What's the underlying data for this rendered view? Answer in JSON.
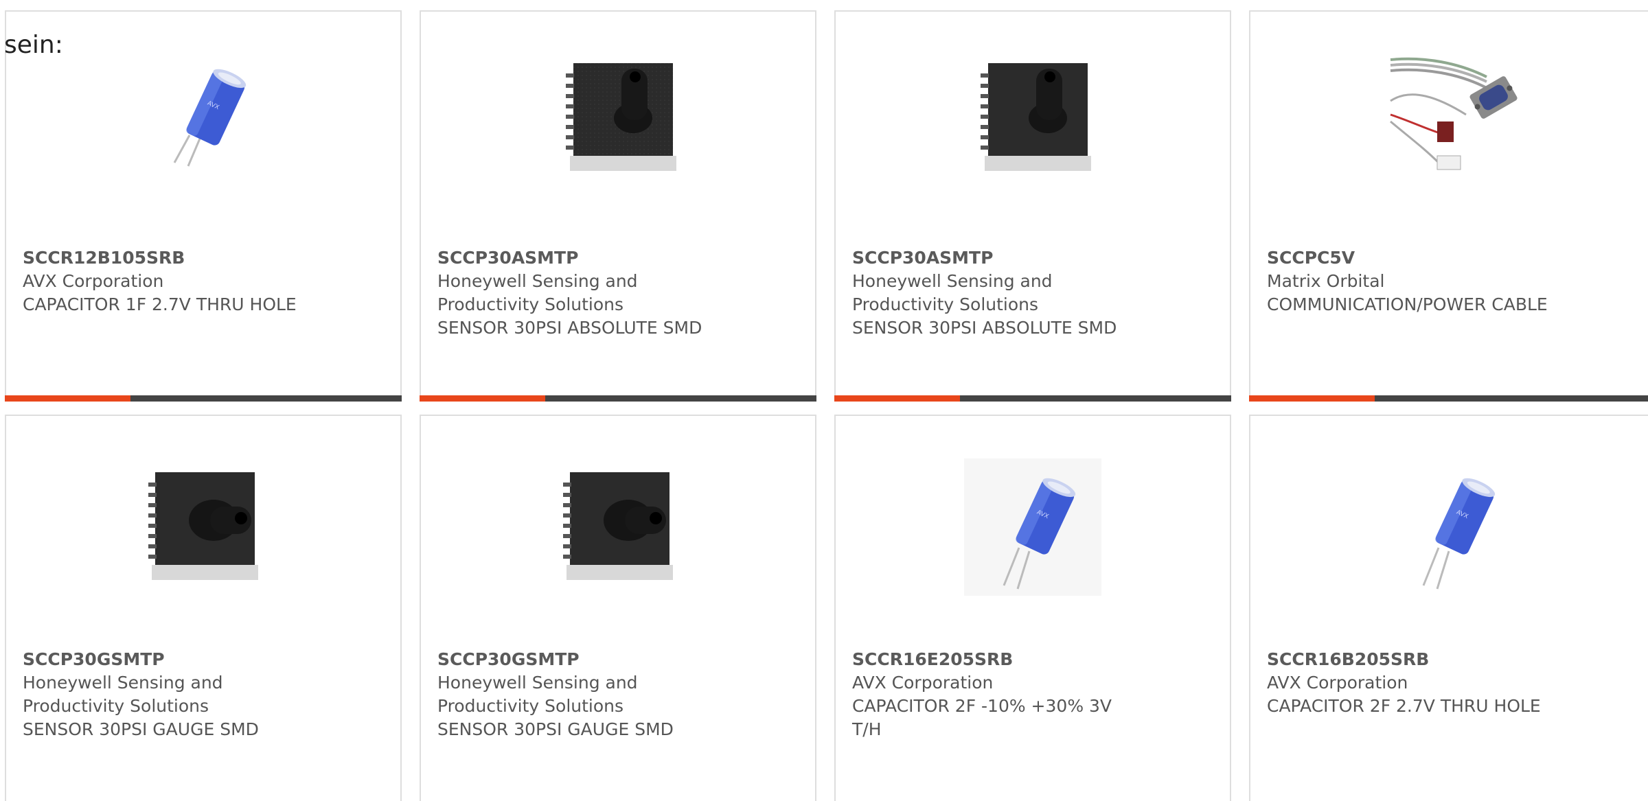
{
  "prefix_text": "sein:",
  "products": [
    {
      "part_number": "SCCR12B105SRB",
      "manufacturer": "AVX Corporation",
      "description": "CAPACITOR 1F 2.7V THRU HOLE",
      "image_icon": "capacitor-icon"
    },
    {
      "part_number": "SCCP30ASMTP",
      "manufacturer_line1": "Honeywell Sensing and",
      "manufacturer_line2": "Productivity Solutions",
      "description": "SENSOR 30PSI ABSOLUTE SMD",
      "image_icon": "pressure-sensor-icon"
    },
    {
      "part_number": "SCCP30ASMTP",
      "manufacturer_line1": "Honeywell Sensing and",
      "manufacturer_line2": "Productivity Solutions",
      "description": "SENSOR 30PSI ABSOLUTE SMD",
      "image_icon": "pressure-sensor-icon"
    },
    {
      "part_number": "SCCPC5V",
      "manufacturer": "Matrix Orbital",
      "description": "COMMUNICATION/POWER CABLE",
      "image_icon": "cable-icon"
    },
    {
      "part_number": "SCCP30GSMTP",
      "manufacturer_line1": "Honeywell Sensing and",
      "manufacturer_line2": "Productivity Solutions",
      "description": "SENSOR 30PSI GAUGE SMD",
      "image_icon": "pressure-sensor-icon"
    },
    {
      "part_number": "SCCP30GSMTP",
      "manufacturer_line1": "Honeywell Sensing and",
      "manufacturer_line2": "Productivity Solutions",
      "description": "SENSOR 30PSI GAUGE SMD",
      "image_icon": "pressure-sensor-icon"
    },
    {
      "part_number": "SCCR16E205SRB",
      "manufacturer": "AVX Corporation",
      "description_line1": "CAPACITOR 2F -10% +30% 3V",
      "description_line2": "T/H",
      "image_icon": "capacitor-icon"
    },
    {
      "part_number": "SCCR16B205SRB",
      "manufacturer": "AVX Corporation",
      "description": "CAPACITOR 2F 2.7V THRU HOLE",
      "image_icon": "capacitor-icon"
    }
  ],
  "colors": {
    "accent": "#e8461b",
    "bar_dark": "#444444",
    "card_border": "#dedede",
    "text": "#555555"
  }
}
